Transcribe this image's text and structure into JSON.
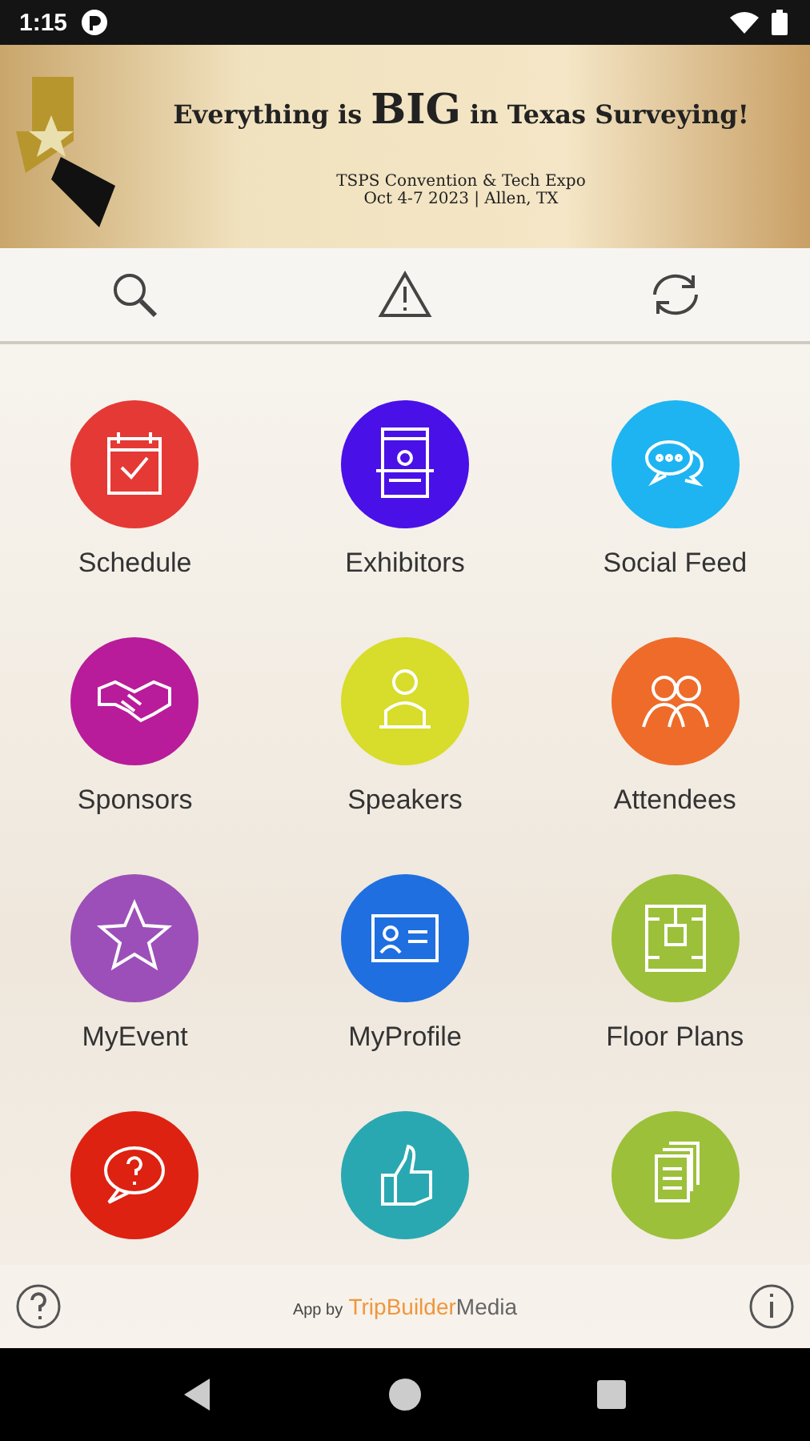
{
  "status_bar": {
    "time": "1:15"
  },
  "banner": {
    "headline": "Everything is **BIG** in Texas Surveying!",
    "event": "TSPS Convention & Tech Expo",
    "when": "Oct 4-7 2023 | Allen, TX"
  },
  "toolbar": [
    {
      "kind": "search"
    },
    {
      "kind": "alert"
    },
    {
      "kind": "sync"
    }
  ],
  "tiles": [
    {
      "label": "Schedule",
      "color": "#e53935",
      "kind": "calendar"
    },
    {
      "label": "Exhibitors",
      "color": "#4a10e8",
      "kind": "booth"
    },
    {
      "label": "Social Feed",
      "color": "#1eb4f2",
      "kind": "chat"
    },
    {
      "label": "Sponsors",
      "color": "#b81c9a",
      "kind": "handshake"
    },
    {
      "label": "Speakers",
      "color": "#d8dc2a",
      "kind": "speaker"
    },
    {
      "label": "Attendees",
      "color": "#ee6b2a",
      "kind": "people"
    },
    {
      "label": "MyEvent",
      "color": "#9c4fb8",
      "kind": "star"
    },
    {
      "label": "MyProfile",
      "color": "#1f6fe0",
      "kind": "idcard"
    },
    {
      "label": "Floor Plans",
      "color": "#9cc03a",
      "kind": "floorplan"
    },
    {
      "color": "#dd2211",
      "kind": "question"
    },
    {
      "color": "#2aa8b2",
      "kind": "thumb"
    },
    {
      "color": "#9cc03a",
      "kind": "docs"
    }
  ],
  "footer": {
    "prefix": "App by",
    "brand": "TripBuilder",
    "brand_suffix": "Media"
  }
}
